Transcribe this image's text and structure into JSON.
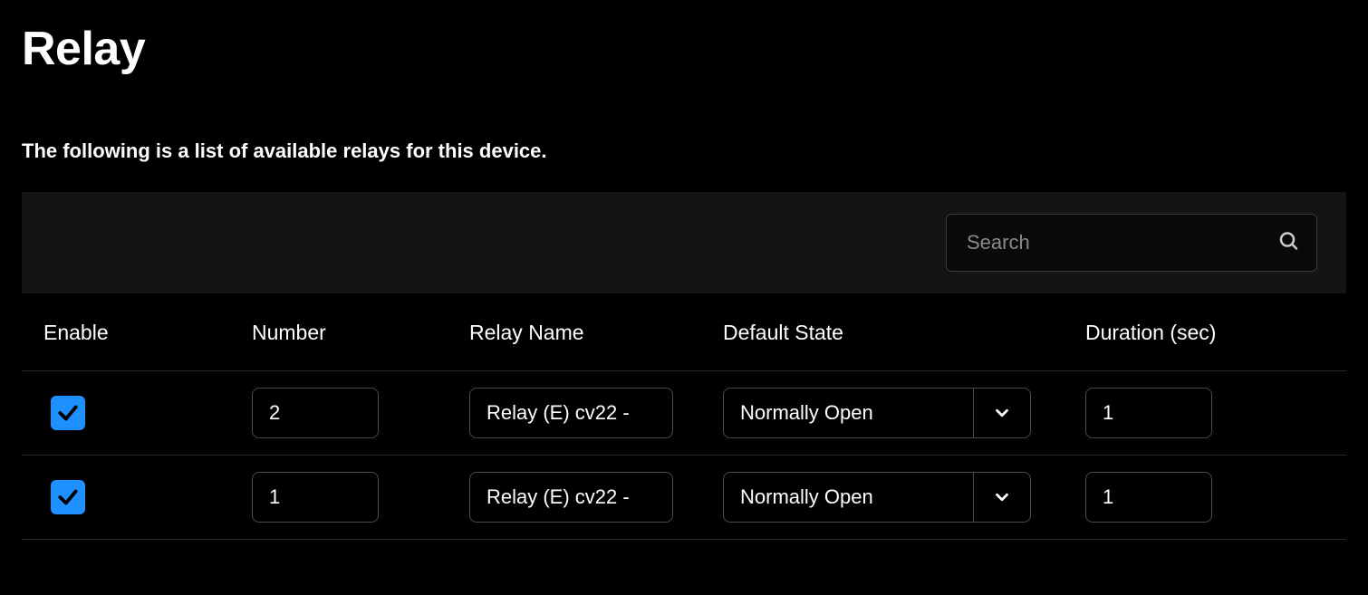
{
  "title": "Relay",
  "description": "The following is a list of available relays for this device.",
  "search": {
    "placeholder": "Search",
    "value": ""
  },
  "columns": {
    "enable": "Enable",
    "number": "Number",
    "name": "Relay Name",
    "state": "Default State",
    "duration": "Duration (sec)"
  },
  "rows": [
    {
      "enabled": true,
      "number": "2",
      "name": "Relay (E) cv22 -",
      "state": "Normally Open",
      "duration": "1"
    },
    {
      "enabled": true,
      "number": "1",
      "name": "Relay (E) cv22 -",
      "state": "Normally Open",
      "duration": "1"
    }
  ]
}
